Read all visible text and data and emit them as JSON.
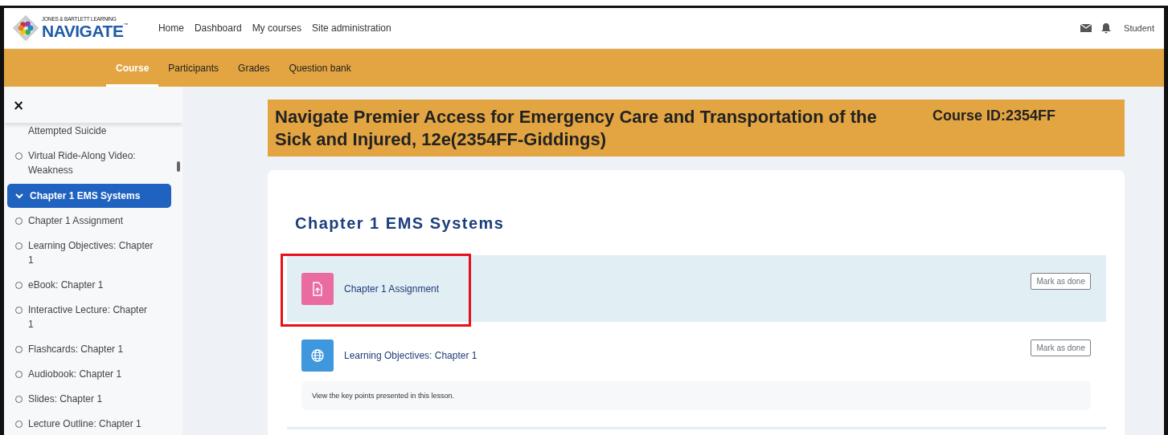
{
  "header": {
    "logo": {
      "publisher": "JONES & BARTLETT LEARNING",
      "name": "NAVIGATE",
      "mark": "™"
    },
    "nav_links": [
      "Home",
      "Dashboard",
      "My courses",
      "Site administration"
    ],
    "user": "Student"
  },
  "course_tabs": [
    {
      "label": "Course",
      "selected": true
    },
    {
      "label": "Participants",
      "selected": false
    },
    {
      "label": "Grades",
      "selected": false
    },
    {
      "label": "Question bank",
      "selected": false
    }
  ],
  "sidebar": {
    "close": "×",
    "items": [
      {
        "kind": "continuation",
        "label": "Attempted Suicide"
      },
      {
        "kind": "activity",
        "label": "Virtual Ride-Along Video: Weakness"
      },
      {
        "kind": "section",
        "label": "Chapter 1 EMS Systems",
        "selected": true,
        "expanded": true
      },
      {
        "kind": "activity",
        "label": "Chapter 1 Assignment"
      },
      {
        "kind": "activity",
        "label": "Learning Objectives: Chapter 1"
      },
      {
        "kind": "activity",
        "label": "eBook: Chapter 1"
      },
      {
        "kind": "activity",
        "label": "Interactive Lecture: Chapter 1"
      },
      {
        "kind": "activity",
        "label": "Flashcards: Chapter 1"
      },
      {
        "kind": "activity",
        "label": "Audiobook: Chapter 1"
      },
      {
        "kind": "activity",
        "label": "Slides: Chapter 1"
      },
      {
        "kind": "activity",
        "label": "Lecture Outline: Chapter 1"
      }
    ]
  },
  "course": {
    "title": "Navigate Premier Access for Emergency Care and Transportation of the Sick and Injured, 12e(2354FF-Giddings)",
    "course_id": "Course ID:2354FF"
  },
  "section": {
    "title": "Chapter 1 EMS Systems",
    "activities": [
      {
        "kind": "assignment",
        "name": "Chapter 1 Assignment",
        "button": "Mark as done",
        "highlighted": true
      },
      {
        "kind": "url",
        "name": "Learning Objectives: Chapter 1",
        "button": "Mark as done",
        "highlighted": false,
        "description": "View the key points presented in this lesson."
      }
    ]
  }
}
